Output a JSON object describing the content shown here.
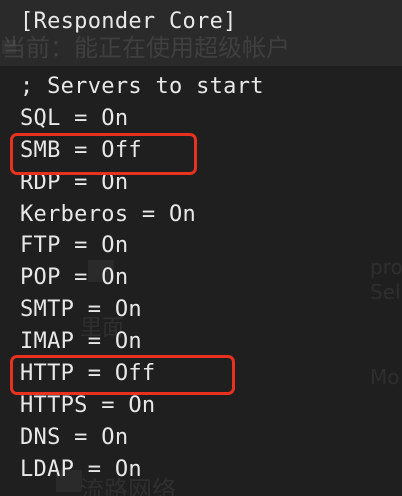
{
  "config": {
    "section_header": "[Responder Core]",
    "comment": "; Servers to start",
    "lines": [
      "SQL = On",
      "SMB = Off",
      "RDP = On",
      "Kerberos = On",
      "FTP = On",
      "POP = On",
      "SMTP = On",
      "IMAP = On",
      "HTTP = Off",
      "HTTPS = On",
      "DNS = On",
      "LDAP = On"
    ]
  },
  "annotations": {
    "highlight_color": "#e8321f",
    "highlighted_lines": [
      "SMB = Off",
      "HTTP = Off"
    ]
  },
  "background_overlay": {
    "text_1": "当前：能正在使用超级帐户",
    "text_2": "pro",
    "text_3": "Sel",
    "text_4": "Mo",
    "text_5": "里面",
    "text_6": "流路网络"
  },
  "colors": {
    "background": "#1f1f1f",
    "text": "#e8e8e8"
  }
}
